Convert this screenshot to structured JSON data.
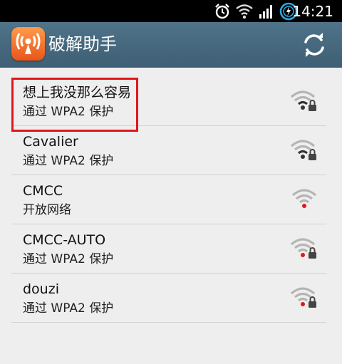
{
  "status_bar": {
    "time": "14:21",
    "icons": [
      "alarm-icon",
      "wifi-signal-icon",
      "cell-signal-icon",
      "battery-icon"
    ]
  },
  "action_bar": {
    "title": "破解助手",
    "app_icon": "radio-tower-icon",
    "refresh_icon": "refresh-icon"
  },
  "networks": [
    {
      "ssid": "想上我没那么容易",
      "security": "通过 WPA2 保护",
      "locked": true,
      "connected_dot": false
    },
    {
      "ssid": "Cavalier",
      "security": "通过 WPA2 保护",
      "locked": true,
      "connected_dot": false
    },
    {
      "ssid": "CMCC",
      "security": "开放网络",
      "locked": false,
      "connected_dot": true
    },
    {
      "ssid": "CMCC-AUTO",
      "security": "通过 WPA2 保护",
      "locked": true,
      "connected_dot": true
    },
    {
      "ssid": "douzi",
      "security": "通过 WPA2 保护",
      "locked": true,
      "connected_dot": true
    }
  ],
  "colors": {
    "action_bar": "#46697e",
    "highlight": "#e3141d",
    "dot_red": "#e3141d",
    "wifi_gray": "#b4b4b4"
  }
}
